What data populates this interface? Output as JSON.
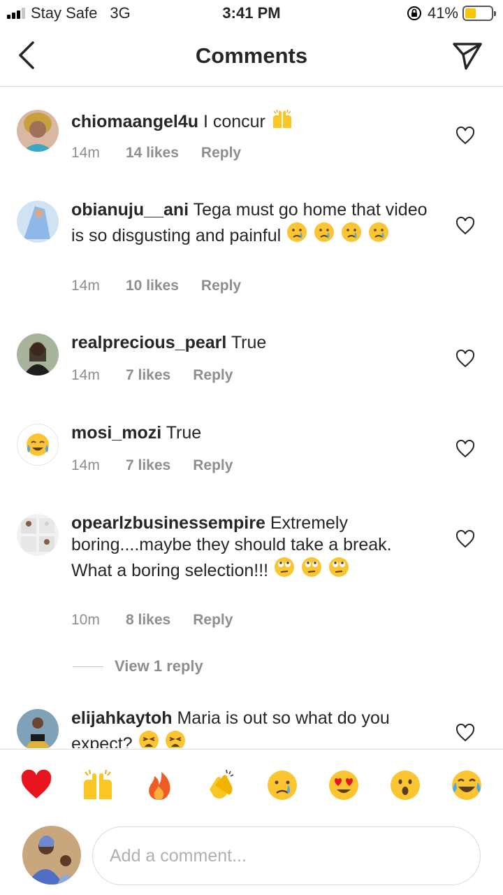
{
  "status_bar": {
    "carrier": "Stay Safe",
    "network": "3G",
    "time": "3:41 PM",
    "battery": "41%",
    "battery_level": 0.41
  },
  "header": {
    "title": "Comments"
  },
  "comments": [
    {
      "username": "chiomaangel4u",
      "text": "I concur",
      "time": "14m",
      "likes": "14 likes",
      "reply": "Reply",
      "emoji": "raising-hands"
    },
    {
      "username": "obianuju__ani",
      "text": "Tega must go home that video is so disgusting and painful",
      "time": "14m",
      "likes": "10 likes",
      "reply": "Reply",
      "emoji": "crying-face"
    },
    {
      "username": "realprecious_pearl",
      "text": "True",
      "time": "14m",
      "likes": "7 likes",
      "reply": "Reply"
    },
    {
      "username": "mosi_mozi",
      "text": "True",
      "time": "14m",
      "likes": "7 likes",
      "reply": "Reply"
    },
    {
      "username": "opearlzbusinessempire",
      "text": "Extremely boring....maybe they should take a break. What a boring selection!!!",
      "time": "10m",
      "likes": "8 likes",
      "reply": "Reply",
      "emoji": "eye-roll-face"
    },
    {
      "username": "elijahkaytoh",
      "text": "Maria is out so what do you expect?",
      "emoji": "weary-face"
    }
  ],
  "view_replies": "View 1 reply",
  "reactions": [
    "red-heart",
    "raising-hands",
    "fire",
    "clapping-hands",
    "crying-face",
    "heart-eyes-face",
    "hushed-face",
    "tears-of-joy-face"
  ],
  "composer": {
    "placeholder": "Add a comment..."
  },
  "colors": {
    "text": "#262626",
    "secondary": "#8e8e8e",
    "divider": "#dbdbdb",
    "battery": "#f7c600"
  }
}
